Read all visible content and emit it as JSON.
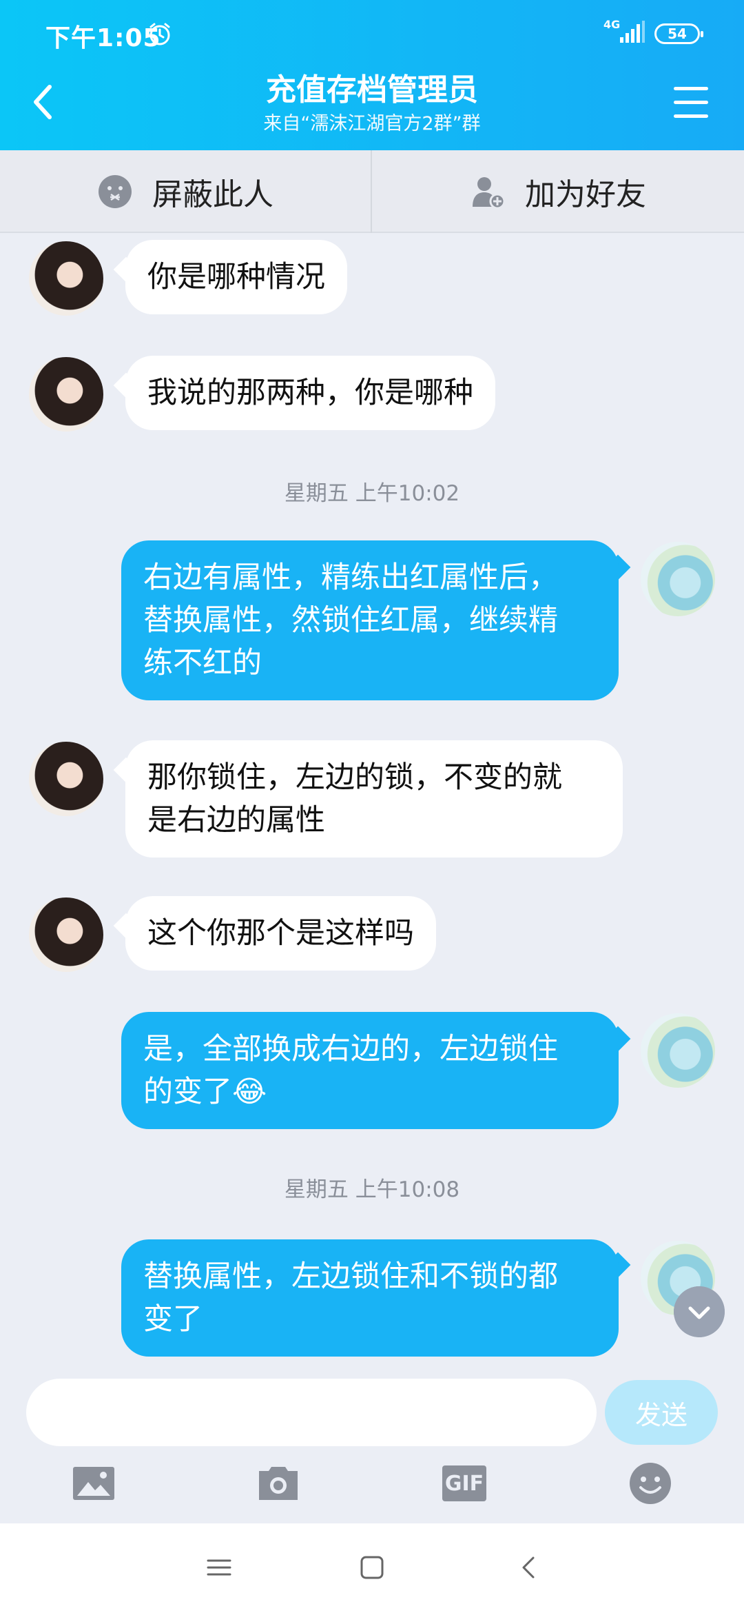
{
  "status_bar": {
    "time": "下午1:05",
    "network": "4G",
    "battery": "54"
  },
  "header": {
    "title": "充值存档管理员",
    "subtitle": "来自“濡沫江湖官方2群”群"
  },
  "actions": {
    "block_label": "屏蔽此人",
    "add_friend_label": "加为好友"
  },
  "messages": [
    {
      "side": "left",
      "text": "你是哪种情况"
    },
    {
      "side": "left",
      "text": "我说的那两种，你是哪种"
    },
    {
      "type": "time",
      "text": "星期五 上午10:02"
    },
    {
      "side": "right",
      "lines": [
        "右边有属性，精练出红属性后，",
        "替换属性，然锁住红属，继续精",
        "练不红的"
      ]
    },
    {
      "side": "left",
      "lines": [
        "那你锁住，左边的锁，不变的就",
        "是右边的属性"
      ]
    },
    {
      "side": "left",
      "text": "这个你那个是这样吗"
    },
    {
      "side": "right",
      "lines": [
        "是，全部换成右边的，左边锁住",
        "的变了"
      ],
      "emoji": "😂"
    },
    {
      "type": "time",
      "text": "星期五 上午10:08"
    },
    {
      "side": "right",
      "lines": [
        "替换属性，左边锁住和不锁的都",
        "变了"
      ]
    }
  ],
  "input": {
    "value": "",
    "send_label": "发送"
  },
  "toolbar": {
    "icons": [
      "image-icon",
      "camera-icon",
      "gif-icon",
      "emoji-icon"
    ],
    "gif_label": "GIF"
  },
  "colors": {
    "header_start": "#0bc6f7",
    "header_end": "#17abf6",
    "bubble_self": "#19b3f5",
    "bubble_other": "#ffffff",
    "background": "#ebeef5"
  }
}
